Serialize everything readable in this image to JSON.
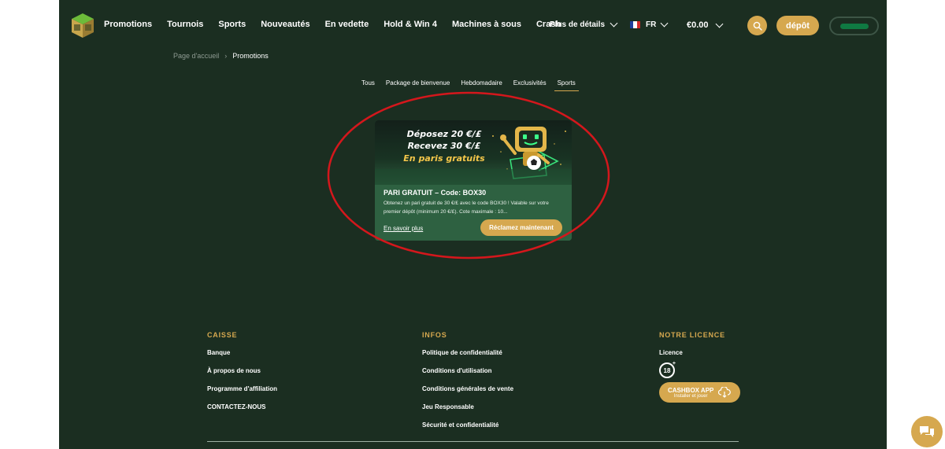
{
  "nav": {
    "items": [
      "Promotions",
      "Tournois",
      "Sports",
      "Nouveautés",
      "En vedette",
      "Hold & Win 4",
      "Machines à sous",
      "Crash"
    ],
    "more_label": "Plus de détails",
    "lang": "FR",
    "balance": "€0.00",
    "deposit_label": "dépôt"
  },
  "breadcrumb": {
    "home": "Page d'accueil",
    "separator": "›",
    "current": "Promotions"
  },
  "tabs": [
    {
      "label": "Tous",
      "active": false
    },
    {
      "label": "Package de bienvenue",
      "active": false
    },
    {
      "label": "Hebdomadaire",
      "active": false
    },
    {
      "label": "Exclusivités",
      "active": false
    },
    {
      "label": "Sports",
      "active": true
    }
  ],
  "promo": {
    "banner_line1": "Déposez 20 €/£",
    "banner_line2": "Recevez 30 €/£",
    "banner_line3": "En paris gratuits",
    "title": "PARI GRATUIT – Code: BOX30",
    "description": "Obtenez un pari gratuit de 30 €/£ avec le code BOX30 ! Valable sur votre premier dépôt (minimum 20 €/£). Cote maximale : 10...",
    "learn_more": "En savoir plus",
    "claim_label": "Réclamez maintenant"
  },
  "footer": {
    "caisse": {
      "heading": "CAISSE",
      "links": [
        "Banque",
        "À propos de nous",
        "Programme d'affiliation",
        "CONTACTEZ-NOUS"
      ]
    },
    "infos": {
      "heading": "INFOS",
      "links": [
        "Politique de confidentialité",
        "Conditions d'utilisation",
        "Conditions générales de vente",
        "Jeu Responsable",
        "Sécurité et confidentialité"
      ]
    },
    "licence": {
      "heading": "NOTRE LICENCE",
      "link": "Licence",
      "age_badge": "18",
      "app_title": "CASHBOX APP",
      "app_subtitle": "Installer et jouer"
    }
  },
  "colors": {
    "background": "#1b2e21",
    "accent": "#d6a84f",
    "card": "#2e6141",
    "annotation": "#d4171c"
  }
}
